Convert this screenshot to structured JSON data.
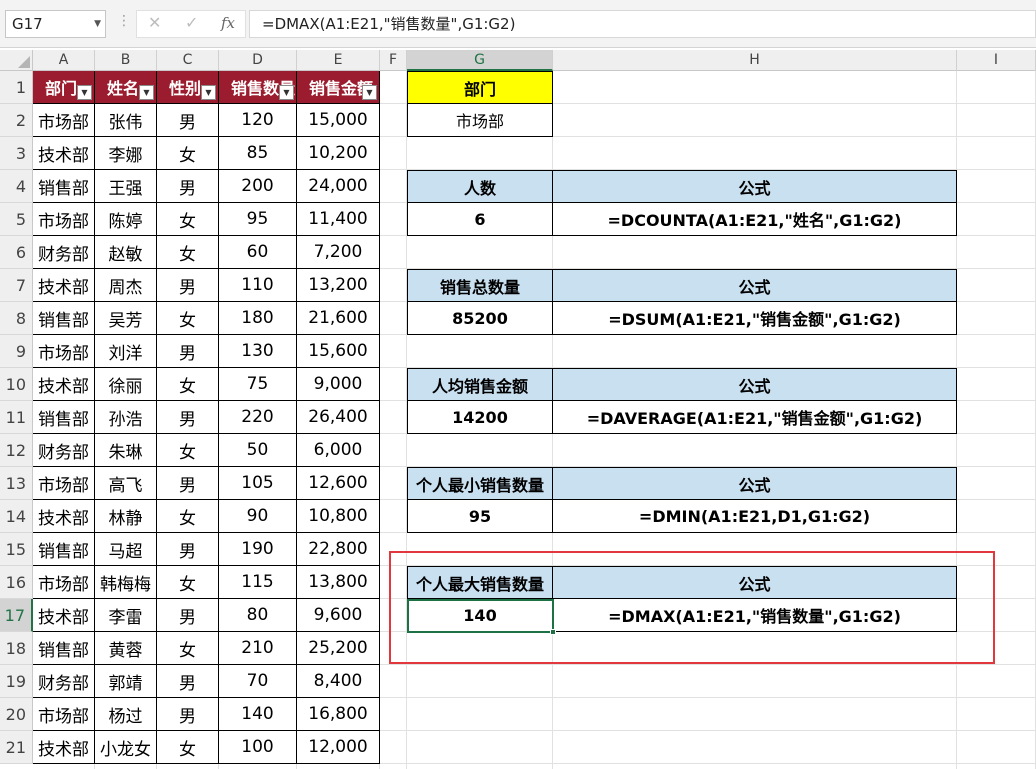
{
  "formula_bar": {
    "name_box": "G17",
    "dots": "⋮",
    "cancel_icon": "✕",
    "confirm_icon": "✓",
    "fx_label": "fx",
    "formula": "=DMAX(A1:E21,\"销售数量\",G1:G2)"
  },
  "columns": [
    "A",
    "B",
    "C",
    "D",
    "E",
    "F",
    "G",
    "H",
    "I"
  ],
  "rows": [
    "1",
    "2",
    "3",
    "4",
    "5",
    "6",
    "7",
    "8",
    "9",
    "10",
    "11",
    "12",
    "13",
    "14",
    "15",
    "16",
    "17",
    "18",
    "19",
    "20",
    "21"
  ],
  "table": {
    "headers": [
      "部门",
      "姓名",
      "性别",
      "销售数量",
      "销售金额"
    ],
    "records": [
      [
        "市场部",
        "张伟",
        "男",
        "120",
        "15,000"
      ],
      [
        "技术部",
        "李娜",
        "女",
        "85",
        "10,200"
      ],
      [
        "销售部",
        "王强",
        "男",
        "200",
        "24,000"
      ],
      [
        "市场部",
        "陈婷",
        "女",
        "95",
        "11,400"
      ],
      [
        "财务部",
        "赵敏",
        "女",
        "60",
        "7,200"
      ],
      [
        "技术部",
        "周杰",
        "男",
        "110",
        "13,200"
      ],
      [
        "销售部",
        "吴芳",
        "女",
        "180",
        "21,600"
      ],
      [
        "市场部",
        "刘洋",
        "男",
        "130",
        "15,600"
      ],
      [
        "技术部",
        "徐丽",
        "女",
        "75",
        "9,000"
      ],
      [
        "销售部",
        "孙浩",
        "男",
        "220",
        "26,400"
      ],
      [
        "财务部",
        "朱琳",
        "女",
        "50",
        "6,000"
      ],
      [
        "市场部",
        "高飞",
        "男",
        "105",
        "12,600"
      ],
      [
        "技术部",
        "林静",
        "女",
        "90",
        "10,800"
      ],
      [
        "销售部",
        "马超",
        "男",
        "190",
        "22,800"
      ],
      [
        "市场部",
        "韩梅梅",
        "女",
        "115",
        "13,800"
      ],
      [
        "技术部",
        "李雷",
        "男",
        "80",
        "9,600"
      ],
      [
        "销售部",
        "黄蓉",
        "女",
        "210",
        "25,200"
      ],
      [
        "财务部",
        "郭靖",
        "男",
        "70",
        "8,400"
      ],
      [
        "市场部",
        "杨过",
        "男",
        "140",
        "16,800"
      ],
      [
        "技术部",
        "小龙女",
        "女",
        "100",
        "12,000"
      ]
    ]
  },
  "criteria": {
    "header": "部门",
    "value": "市场部"
  },
  "blocks": [
    {
      "label": "人数",
      "formula_header": "公式",
      "value": "6",
      "formula": "=DCOUNTA(A1:E21,\"姓名\",G1:G2)"
    },
    {
      "label": "销售总数量",
      "formula_header": "公式",
      "value": "85200",
      "formula": "=DSUM(A1:E21,\"销售金额\",G1:G2)"
    },
    {
      "label": "人均销售金额",
      "formula_header": "公式",
      "value": "14200",
      "formula": "=DAVERAGE(A1:E21,\"销售金额\",G1:G2)"
    },
    {
      "label": "个人最小销售数量",
      "formula_header": "公式",
      "value": "95",
      "formula": "=DMIN(A1:E21,D1,G1:G2)"
    },
    {
      "label": "个人最大销售数量",
      "formula_header": "公式",
      "value": "140",
      "formula": "=DMAX(A1:E21,\"销售数量\",G1:G2)"
    }
  ],
  "colors": {
    "header_fill": "#9b1c2e",
    "criteria_fill": "#ffff00",
    "block_header_fill": "#c9e0f1",
    "highlight_border": "#e0383d",
    "active_cell_border": "#1e7145"
  },
  "active_cell": "G17"
}
